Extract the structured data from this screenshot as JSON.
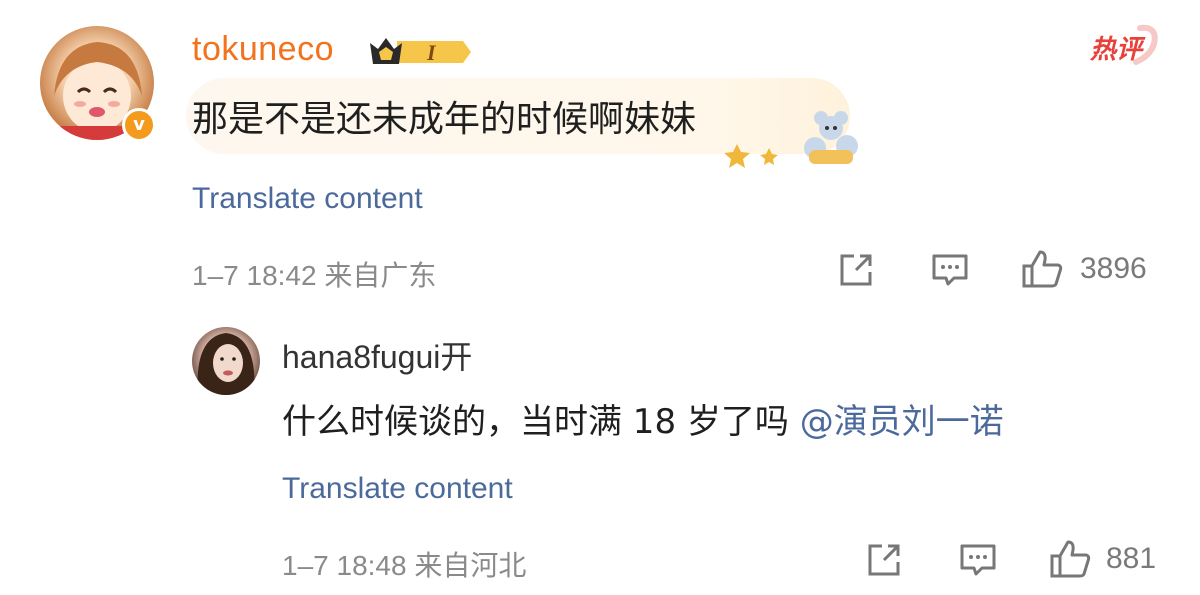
{
  "comment": {
    "username": "tokuneco",
    "level_badge": "I",
    "hot_label": "热评",
    "verified_mark": "v",
    "text": "那是不是还未成年的时候啊妹妹",
    "translate_label": "Translate content",
    "timestamp": "1–7 18:42 来自广东",
    "likes": "3896",
    "icons": [
      "avatar",
      "level-crown-icon",
      "hot-comment-icon",
      "share-icon",
      "comment-icon",
      "like-icon"
    ]
  },
  "reply": {
    "username": "hana8fugui开",
    "text": "什么时候谈的，当时满 18 岁了吗 ",
    "mention": "@演员刘一诺",
    "translate_label": "Translate content",
    "timestamp": "1–7 18:48 来自河北",
    "likes": "881"
  },
  "colors": {
    "username_orange": "#f3721e",
    "link_blue": "#4b6a9b",
    "meta_gray": "#8a8a8a",
    "hot_red": "#e8413a"
  }
}
